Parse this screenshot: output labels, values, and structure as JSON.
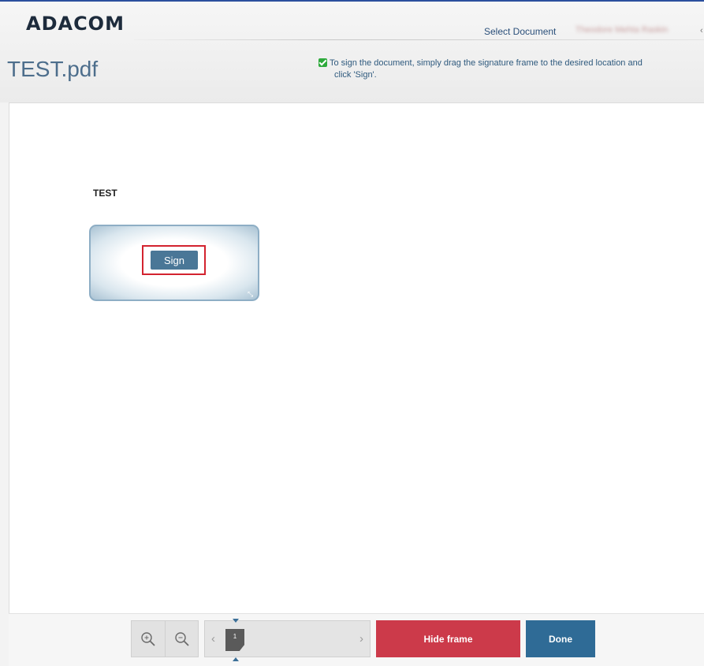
{
  "header": {
    "logo": "ADACOM",
    "nav_select_document": "Select Document",
    "user_name": "Theodore Mehta Raskin",
    "user_caret": "‹"
  },
  "document": {
    "title": "TEST.pdf",
    "notice_line1": "To sign the document, simply drag the signature frame to the desired location and",
    "notice_line2": "click 'Sign'.",
    "body_text": "TEST"
  },
  "signature_frame": {
    "sign_label": "Sign",
    "resize_glyph": "⤡"
  },
  "toolbar": {
    "prev_glyph": "‹",
    "next_glyph": "›",
    "current_page": "1",
    "hide_frame_label": "Hide frame",
    "done_label": "Done"
  },
  "colors": {
    "accent": "#2f6b96",
    "danger": "#cc3a4a",
    "check": "#2eaa3c"
  }
}
